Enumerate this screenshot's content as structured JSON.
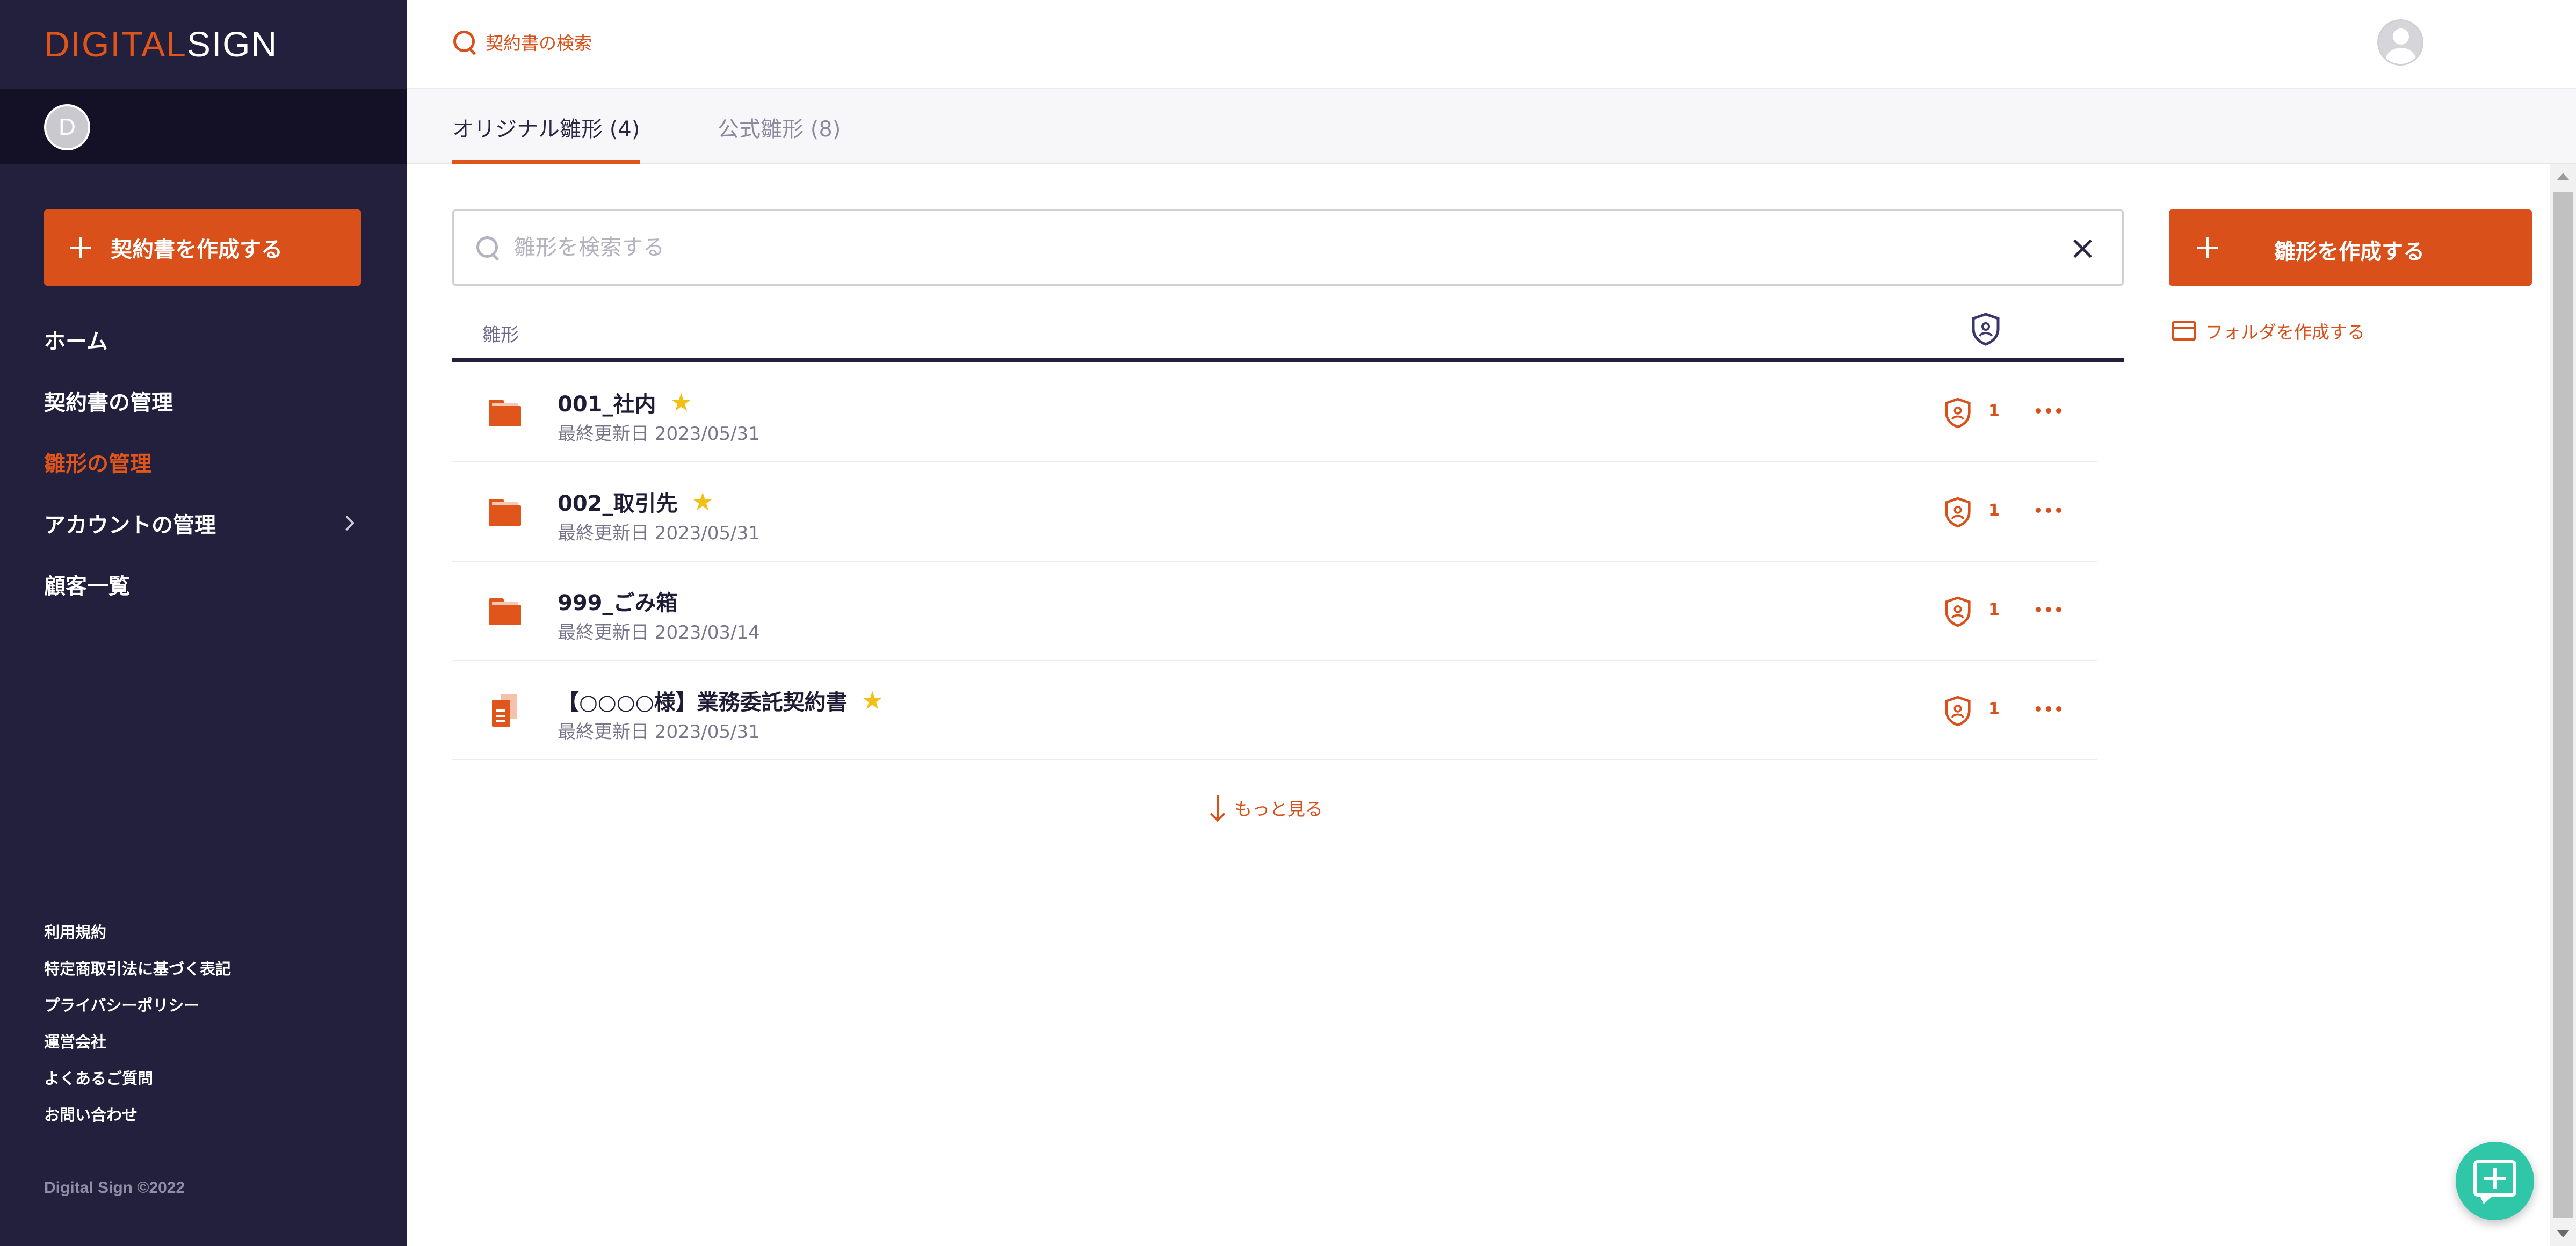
{
  "brand": {
    "logo_part1": "DIGITAL",
    "logo_part2": "SIGN",
    "accent": "#e0561a"
  },
  "sidebar": {
    "user_initial": "D",
    "create_contract_label": "契約書を作成する",
    "nav": [
      {
        "label": "ホーム"
      },
      {
        "label": "契約書の管理"
      },
      {
        "label": "雛形の管理",
        "active": true
      },
      {
        "label": "アカウントの管理",
        "has_children": true
      },
      {
        "label": "顧客一覧"
      }
    ],
    "footer_links": [
      "利用規約",
      "特定商取引法に基づく表記",
      "プライバシーポリシー",
      "運営会社",
      "よくあるご質問",
      "お問い合わせ"
    ],
    "copyright": "Digital Sign ©2022"
  },
  "topbar": {
    "search_label": "契約書の検索"
  },
  "tabs": [
    {
      "label": "オリジナル雛形 (4)",
      "active": true
    },
    {
      "label": "公式雛形 (8)"
    }
  ],
  "search": {
    "placeholder": "雛形を検索する",
    "value": ""
  },
  "list": {
    "column_label": "雛形",
    "rows": [
      {
        "type": "folder",
        "name": "001_社内",
        "starred": true,
        "date": "最終更新日 2023/05/31",
        "count": "1"
      },
      {
        "type": "folder",
        "name": "002_取引先",
        "starred": true,
        "date": "最終更新日 2023/05/31",
        "count": "1"
      },
      {
        "type": "folder",
        "name": "999_ごみ箱",
        "starred": false,
        "date": "最終更新日 2023/03/14",
        "count": "1"
      },
      {
        "type": "document",
        "name": "【○○○○様】業務委託契約書",
        "starred": true,
        "date": "最終更新日 2023/05/31",
        "count": "1"
      }
    ],
    "load_more_label": "もっと見る"
  },
  "right_panel": {
    "create_template_label": "雛形を作成する",
    "create_folder_label": "フォルダを作成する"
  }
}
